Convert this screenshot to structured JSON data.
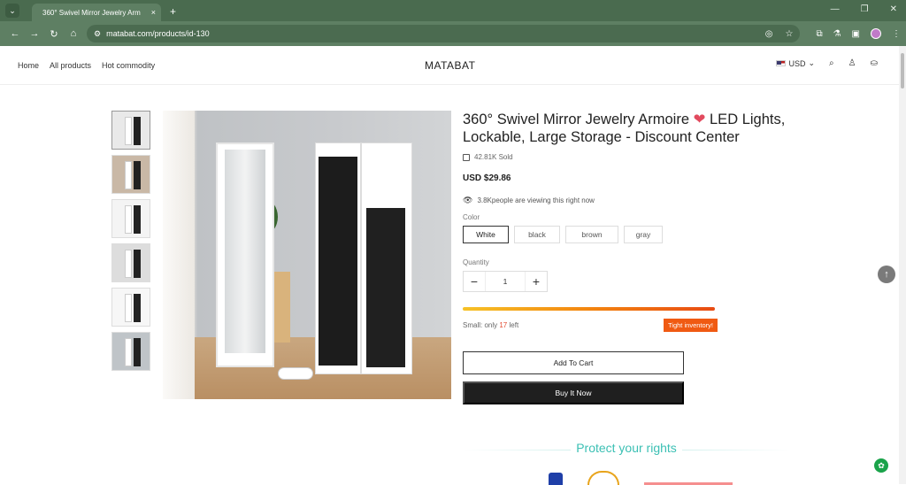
{
  "browser": {
    "tab_title": "360° Swivel Mirror Jewelry Arm",
    "tab_close": "×",
    "new_tab": "+",
    "url": "matabat.com/products/id-130"
  },
  "header": {
    "nav": [
      "Home",
      "All products",
      "Hot commodity"
    ],
    "logo": "MATABAT",
    "currency": "USD"
  },
  "product": {
    "title": "360° Swivel Mirror Jewelry Armoire",
    "title_rest": " LED Lights, Lockable, Large Storage - Discount Center",
    "sold": "42.81K Sold",
    "price": "USD $29.86",
    "viewing": "3.8Kpeople are viewing this right now",
    "color_label": "Color",
    "colors": [
      "White",
      "black",
      "brown",
      "gray"
    ],
    "selected_color": "White",
    "quantity_label": "Quantity",
    "quantity": "1",
    "stock_prefix": "Small: only ",
    "stock_count": "17",
    "stock_suffix": " left",
    "stock_level": 0.95,
    "tight_badge": "Tight inventory!",
    "add_to_cart": "Add To Cart",
    "buy_now": "Buy It Now",
    "protect_title": "Protect your rights"
  },
  "colors": {
    "chrome": "#5e7f63",
    "teal": "#3cc0b4",
    "badge": "#f05a12"
  }
}
